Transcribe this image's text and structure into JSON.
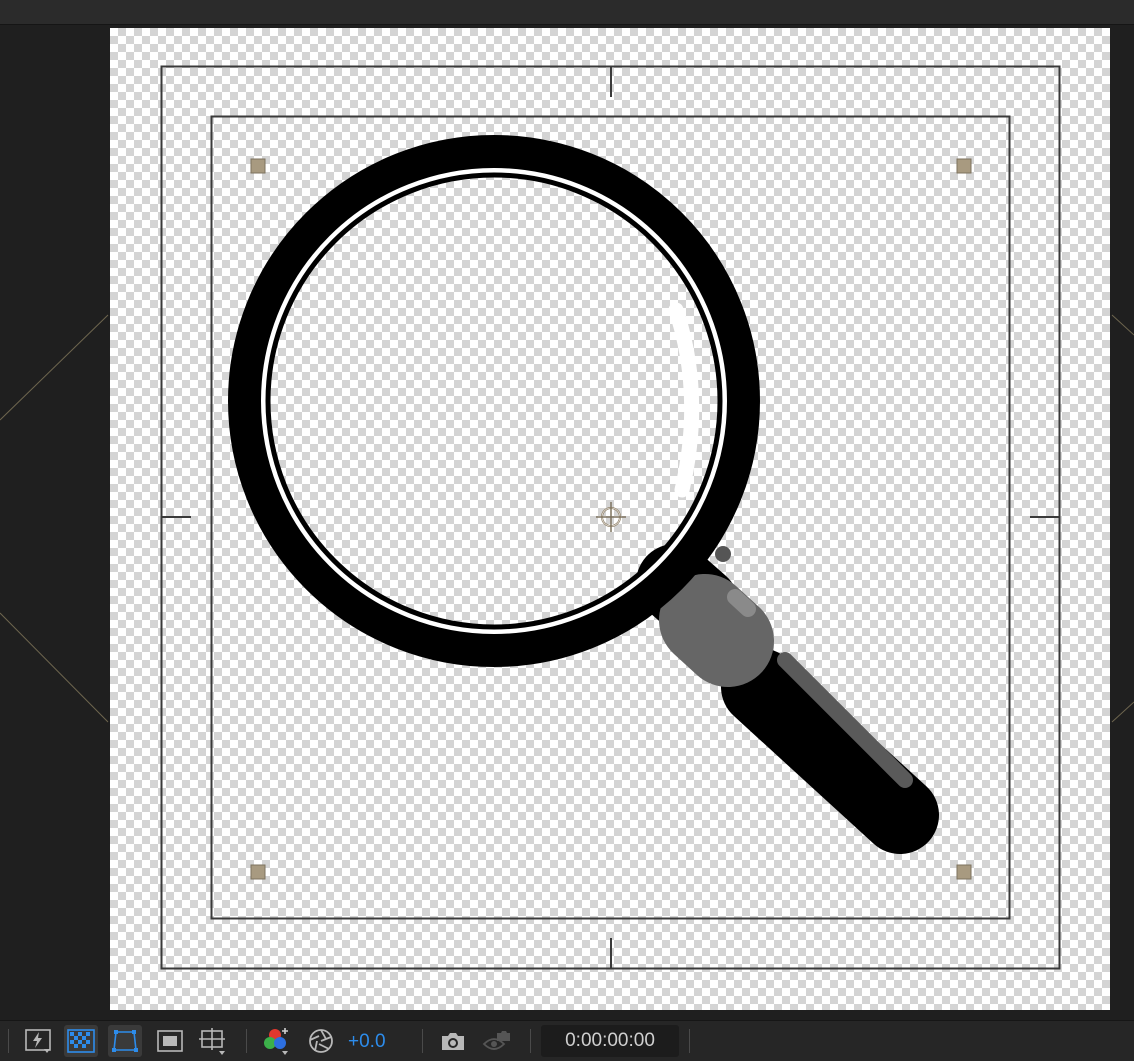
{
  "viewer": {
    "composition": "magnifying-glass",
    "transparency_grid": true,
    "guides": [
      "action-safe",
      "title-safe"
    ]
  },
  "toolbar": {
    "buttons": [
      {
        "name": "fast-previews-button",
        "icon": "lightning-icon"
      },
      {
        "name": "transparency-grid-button",
        "icon": "checkerboard-icon",
        "active": true
      },
      {
        "name": "mask-path-visibility-button",
        "icon": "mask-path-icon",
        "active": true
      },
      {
        "name": "region-of-interest-button",
        "icon": "roi-icon"
      },
      {
        "name": "grid-guide-options-button",
        "icon": "grid-guides-icon"
      },
      {
        "name": "show-channel-button",
        "icon": "color-channels-icon"
      },
      {
        "name": "reset-exposure-button",
        "icon": "aperture-icon"
      },
      {
        "name": "take-snapshot-button",
        "icon": "camera-icon"
      },
      {
        "name": "show-snapshot-button",
        "icon": "show-snapshot-icon",
        "disabled": true
      }
    ],
    "exposure": "+0.0",
    "timecode": "0:00:00:00"
  },
  "colors": {
    "panel": "#262626",
    "accent": "#2d8ceb",
    "handle": "#a89a80"
  }
}
